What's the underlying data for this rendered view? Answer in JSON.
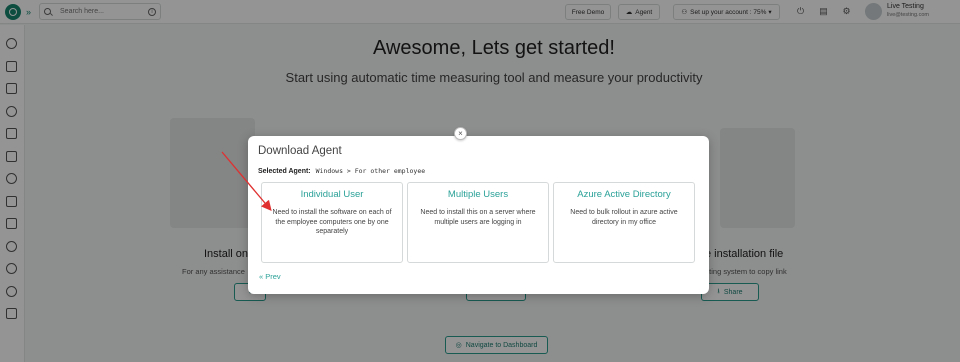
{
  "topbar": {
    "search_placeholder": "Search here...",
    "free_demo": "Free Demo",
    "agent": "Agent",
    "setup": "Set up your account : 75%",
    "user_name": "Live Testing",
    "user_email": "live@testing.com"
  },
  "hero": {
    "title": "Awesome, Lets get started!",
    "subtitle": "Start using automatic time measuring tool and measure your productivity"
  },
  "background": {
    "install_label": "Install on",
    "install_small": "For any assistance",
    "share_label": "e installation file",
    "share_small": "ating system to copy link",
    "share_button": "Share",
    "navigate_button": "Navigate to Dashboard"
  },
  "modal": {
    "title": "Download Agent",
    "selected_label": "Selected Agent:",
    "selected_value": "Windows > For other employee",
    "cards": [
      {
        "title": "Individual User",
        "desc": "Need to install the software on each of the employee computers one by one separately"
      },
      {
        "title": "Multiple Users",
        "desc": "Need to install this on a server where multiple users are logging in"
      },
      {
        "title": "Azure Active Directory",
        "desc": "Need to bulk rollout in azure active directory in my office"
      }
    ],
    "prev": "Prev",
    "close": "×"
  },
  "icons": {
    "logo": "app-logo-icon",
    "annotation": "red-arrow"
  },
  "colors": {
    "accent": "#2aa198",
    "brand": "#16856f",
    "arrow": "#e03030"
  }
}
